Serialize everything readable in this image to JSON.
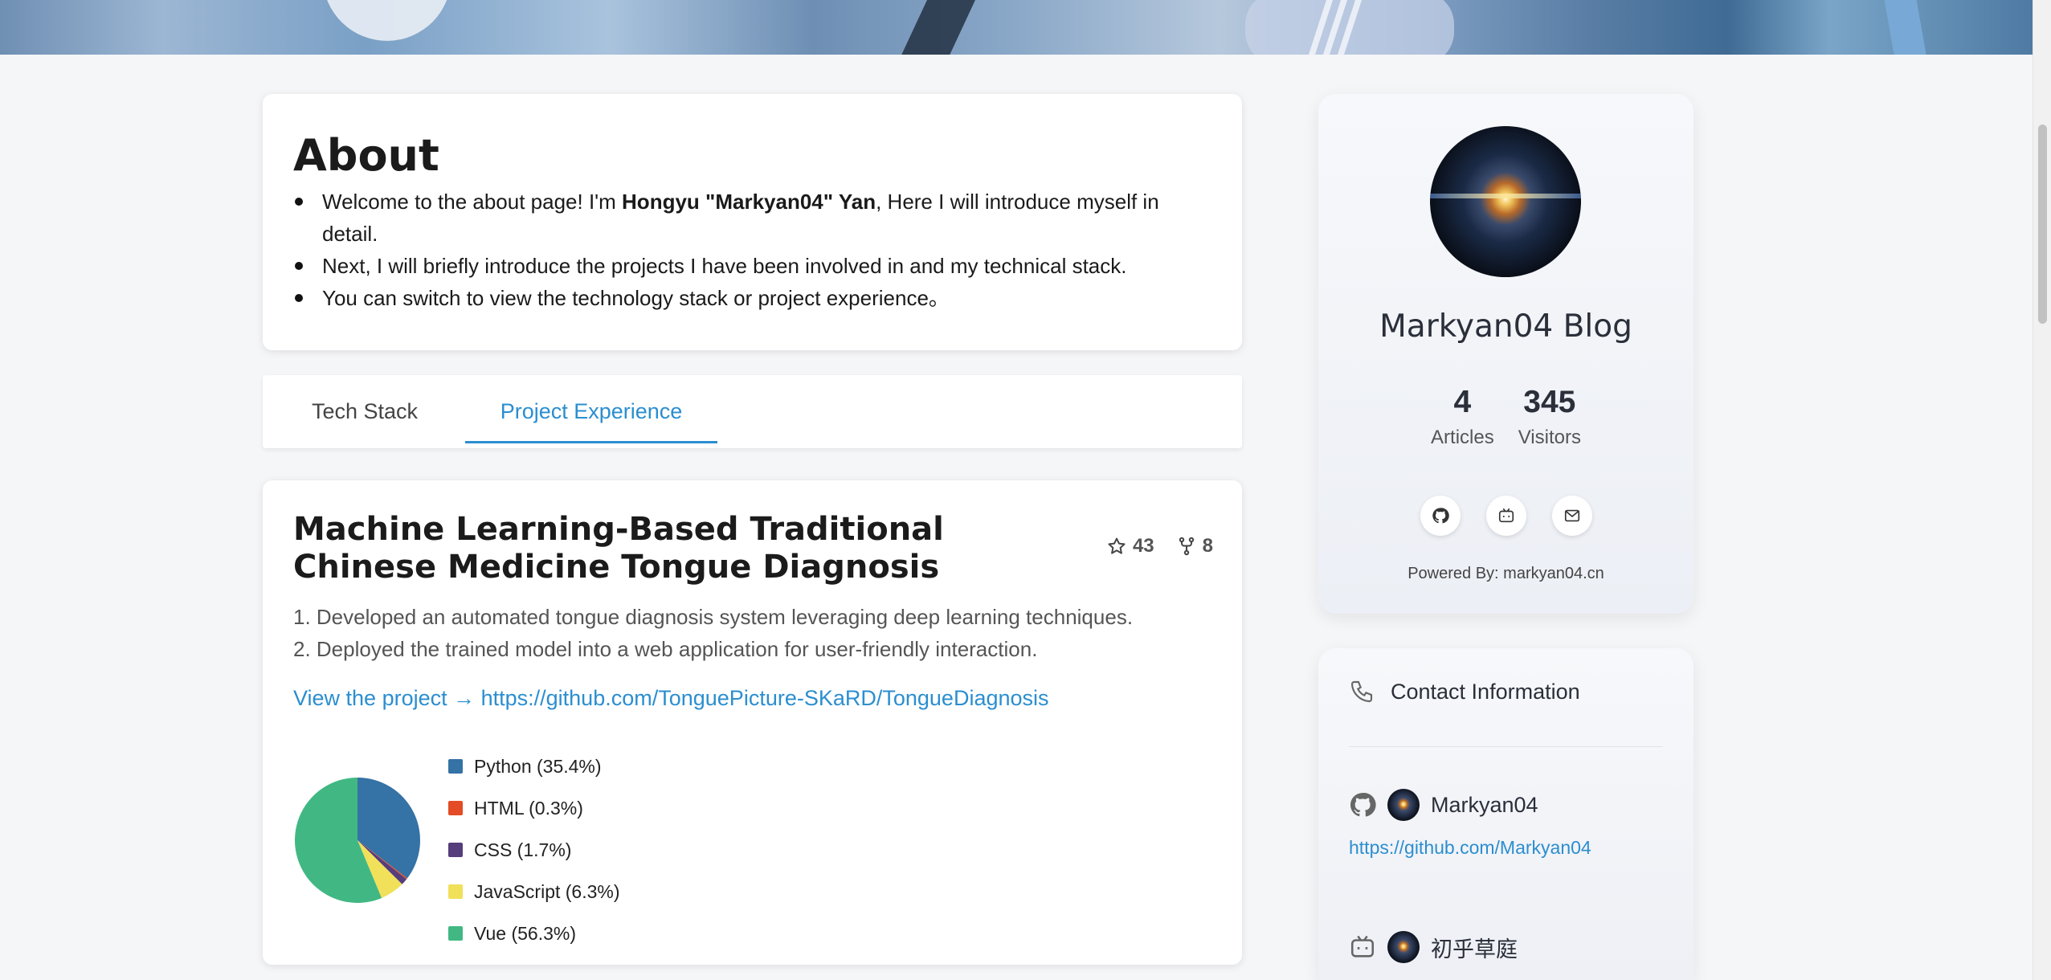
{
  "about": {
    "title": "About",
    "item1_pre": "Welcome to the about page! I'm ",
    "item1_bold": "Hongyu \"Markyan04\" Yan",
    "item1_post": ", Here I will introduce myself in detail.",
    "item2": "Next, I will briefly introduce the projects I have been involved in and my technical stack.",
    "item3": "You can switch to view the technology stack or project experience。"
  },
  "tabs": [
    {
      "label": "Tech Stack",
      "active": false
    },
    {
      "label": "Project Experience",
      "active": true
    }
  ],
  "project": {
    "title": "Machine Learning-Based Traditional Chinese Medicine Tongue Diagnosis",
    "stars": "43",
    "forks": "8",
    "desc1": "1. Developed an automated tongue diagnosis system leveraging deep learning techniques.",
    "desc2": "2. Deployed the trained model into a web application for user-friendly interaction.",
    "link": "View the project → https://github.com/TonguePicture-SKaRD/TongueDiagnosis"
  },
  "chart_data": {
    "type": "pie",
    "categories": [
      "Python",
      "HTML",
      "CSS",
      "JavaScript",
      "Vue"
    ],
    "values": [
      35.4,
      0.3,
      1.7,
      6.3,
      56.3
    ],
    "labels": [
      "Python (35.4%)",
      "HTML (0.3%)",
      "CSS (1.7%)",
      "JavaScript (6.3%)",
      "Vue (56.3%)"
    ],
    "colors": [
      "#3572A5",
      "#e34c26",
      "#563d7c",
      "#f1e05a",
      "#41b883"
    ],
    "legend": "right"
  },
  "profile": {
    "blog_title": "Markyan04 Blog",
    "articles_count": "4",
    "articles_label": "Articles",
    "visitors_count": "345",
    "visitors_label": "Visitors",
    "powered": "Powered By: markyan04.cn"
  },
  "contact": {
    "heading": "Contact Information",
    "github_name": "Markyan04",
    "github_url": "https://github.com/Markyan04",
    "bilibili_name": "初乎草庭"
  },
  "icons": {
    "star": "star-icon",
    "fork": "fork-icon",
    "github": "github-icon",
    "bilibili": "bilibili-icon",
    "mail": "mail-icon",
    "phone": "phone-icon"
  },
  "colors": {
    "accent": "#2b8ed0",
    "background": "#f5f6f8"
  }
}
